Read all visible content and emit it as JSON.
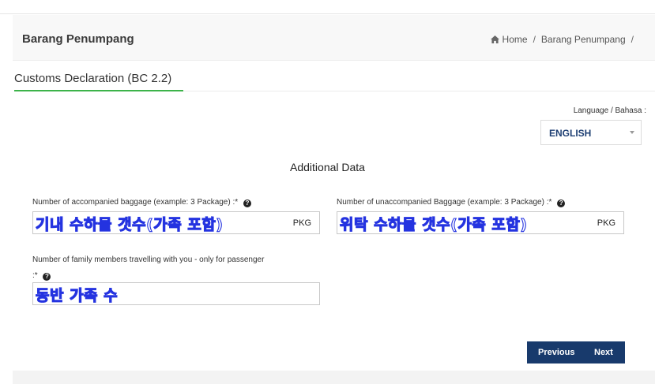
{
  "header": {
    "title": "Barang Penumpang",
    "breadcrumb": [
      "Home",
      "Barang Penumpang"
    ],
    "separator": "/"
  },
  "tab": {
    "title": "Customs Declaration (BC 2.2)",
    "accent": "#3cb34a"
  },
  "language": {
    "label": "Language / Bahasa :",
    "selected": "ENGLISH"
  },
  "section": {
    "title": "Additional Data"
  },
  "fields": {
    "accompanied": {
      "label": "Number of accompanied baggage (example: 3 Package) :*",
      "value": "기내 수하물 갯수(가족 포함)",
      "unit": "PKG"
    },
    "unaccompanied": {
      "label": "Number of unaccompanied Baggage (example: 3 Package) :*",
      "value": "위탁 수하물 갯수(가족 포함)",
      "unit": "PKG"
    },
    "family": {
      "label": "Number of family members travelling with you - only for passenger",
      "label_suffix": ":*",
      "value": "동반 가족 수"
    }
  },
  "buttons": {
    "previous": "Previous",
    "next": "Next",
    "color": "#183a6c"
  },
  "icons": {
    "home": "home-icon",
    "help": "question-circle-icon",
    "caret": "chevron-down-icon"
  },
  "help_glyph": "?"
}
